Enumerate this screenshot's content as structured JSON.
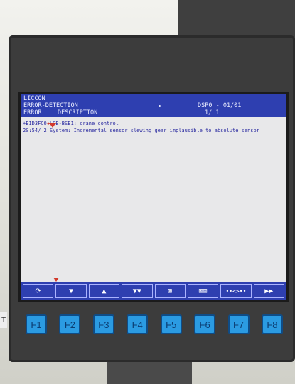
{
  "header": {
    "app": "LICCON",
    "title": "ERROR-DETECTION",
    "col_error": "ERROR",
    "col_desc": "DESCRIPTION",
    "page_id": "DSP0 - 01/01",
    "record_counter": "1/ 1"
  },
  "entries": [
    {
      "code": "+E1D3FC0",
      "module": "LSB-BSE1: crane control",
      "time": "20:54/ 2",
      "message": "System: Incremental sensor slewing gear implausible to absolute sensor"
    }
  ],
  "softkeys": [
    {
      "icon": "refresh-icon",
      "glyph": "⟳"
    },
    {
      "icon": "arrow-down-icon",
      "glyph": "▼"
    },
    {
      "icon": "arrow-up-icon",
      "glyph": "▲"
    },
    {
      "icon": "double-down-icon",
      "glyph": "▼▼"
    },
    {
      "icon": "clear-icon",
      "glyph": "⊠"
    },
    {
      "icon": "clear-all-icon",
      "glyph": "⊠⊠"
    },
    {
      "icon": "toggle-icon",
      "glyph": "••<>••"
    },
    {
      "icon": "fast-forward-icon",
      "glyph": "▶▶"
    }
  ],
  "fkeys": [
    "F1",
    "F2",
    "F3",
    "F4",
    "F5",
    "F6",
    "F7",
    "F8"
  ],
  "edge_label": "T",
  "colors": {
    "screen_blue": "#2e3fb0",
    "fkey_blue": "#2b9be2",
    "marker_red": "#d23a2c"
  }
}
